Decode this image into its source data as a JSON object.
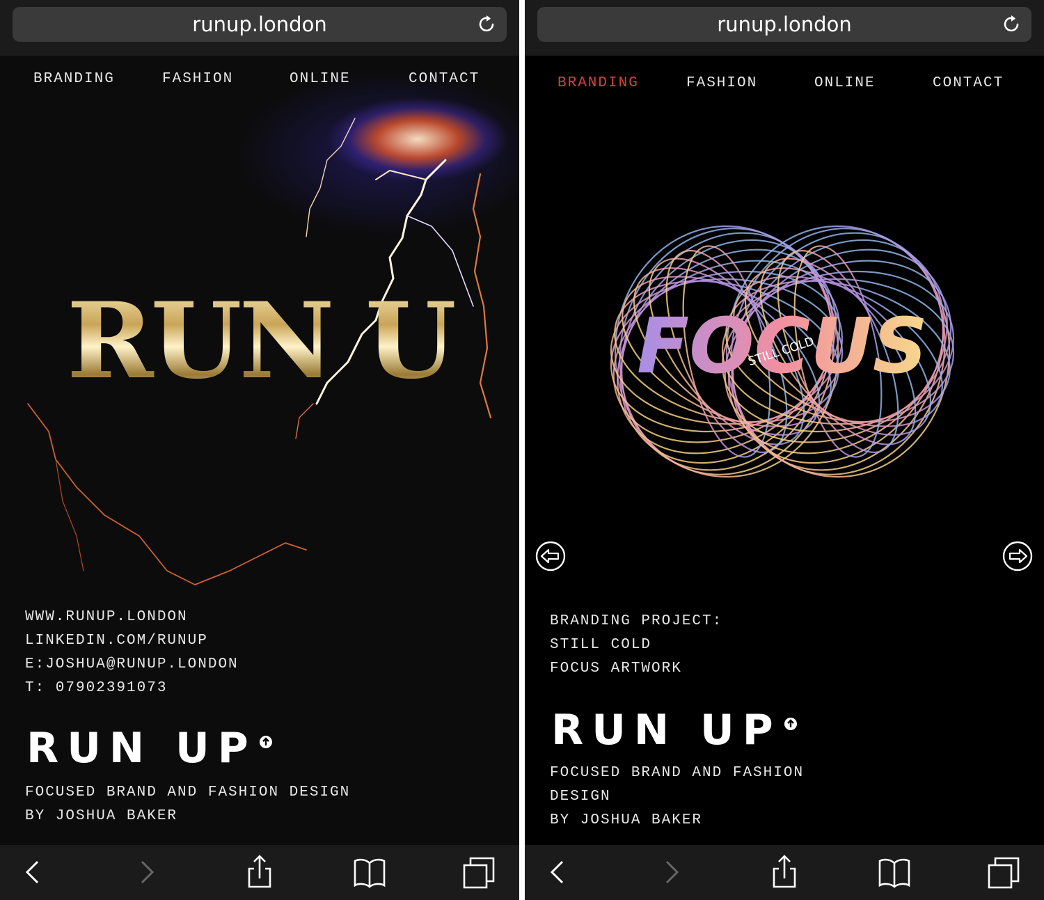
{
  "screens": [
    {
      "url": "runup.london",
      "nav": [
        "BRANDING",
        "FASHION",
        "ONLINE",
        "CONTACT"
      ],
      "active_nav": null,
      "hero_title": "RUN UP",
      "contact_lines": [
        "WWW.RUNUP.LONDON",
        "LINKEDIN.COM/RUNUP",
        "E:JOSHUA@RUNUP.LONDON",
        "T: 07902391073"
      ],
      "logo": "RUN UP",
      "tagline_lines": [
        "FOCUSED BRAND AND FASHION DESIGN",
        "BY JOSHUA BAKER"
      ]
    },
    {
      "url": "runup.london",
      "nav": [
        "BRANDING",
        "FASHION",
        "ONLINE",
        "CONTACT"
      ],
      "active_nav": "BRANDING",
      "artwork_title": "FOCUS",
      "artwork_subtitle": "STILL COLD",
      "project_lines": [
        "BRANDING PROJECT:",
        "STILL COLD",
        "FOCUS ARTWORK"
      ],
      "logo": "RUN UP",
      "tagline_lines": [
        "FOCUSED BRAND AND FASHION",
        "DESIGN",
        "BY JOSHUA BAKER"
      ]
    }
  ],
  "toolbar_icons": [
    "back-icon",
    "forward-icon",
    "share-icon",
    "bookmarks-icon",
    "tabs-icon"
  ],
  "colors": {
    "active_nav": "#d9413b",
    "browser_chrome": "#1b1b1b",
    "url_field": "#3a3a3a"
  }
}
